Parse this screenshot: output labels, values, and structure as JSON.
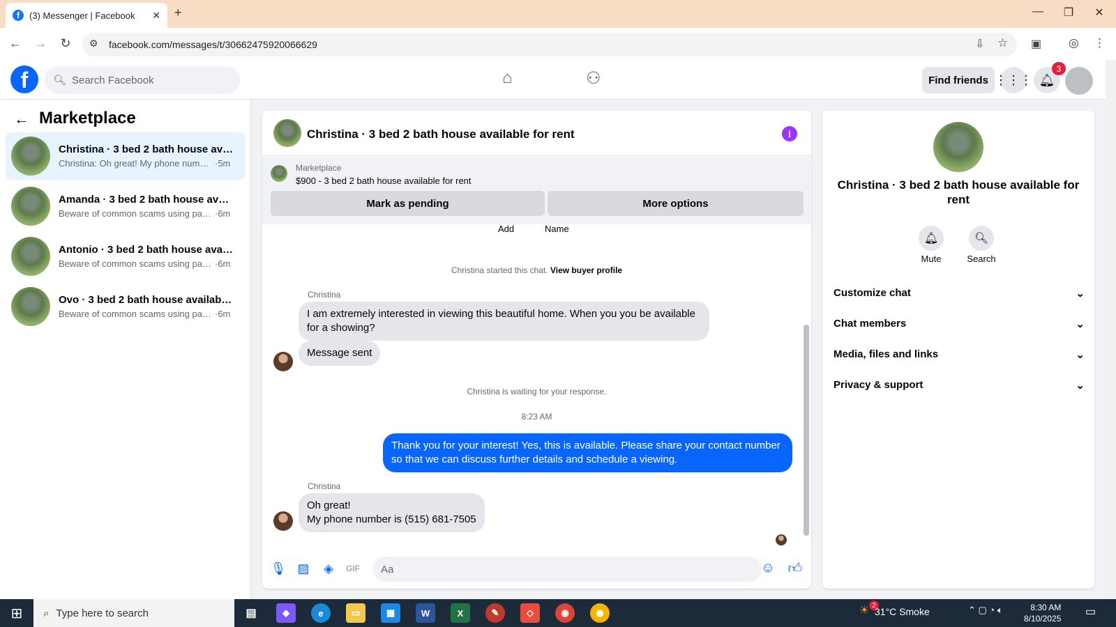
{
  "browser": {
    "tab_title": "(3) Messenger | Facebook",
    "url": "facebook.com/messages/t/30662475920066629",
    "icons": [
      "back-icon",
      "forward-icon",
      "reload-icon",
      "site-info-icon",
      "install-icon",
      "star-icon",
      "media-icon",
      "profile-icon",
      "menu-icon"
    ]
  },
  "fb_header": {
    "search_placeholder": "Search Facebook",
    "find_friends": "Find friends",
    "notif_count": "3"
  },
  "left": {
    "title": "Marketplace",
    "conversations": [
      {
        "name": "Christina · 3 bed 2 bath house avai...",
        "snippet": "Christina: Oh great! My phone numb...",
        "time": "·5m",
        "active": true
      },
      {
        "name": "Amanda · 3 bed 2 bath house avail...",
        "snippet": "Beware of common scams using pay...",
        "time": "·6m"
      },
      {
        "name": "Antonio · 3 bed 2 bath house avail...",
        "snippet": "Beware of common scams using pay...",
        "time": "·6m"
      },
      {
        "name": "Ovo · 3 bed 2 bath house available...",
        "snippet": "Beware of common scams using pay...",
        "time": "·6m"
      }
    ]
  },
  "chat": {
    "title": "Christina · 3 bed 2 bath house available for rent",
    "marketplace_label": "Marketplace",
    "listing": "$900 - 3 bed 2 bath house available for rent",
    "mark_pending": "Mark as pending",
    "more_options": "More options",
    "add_label": "Add",
    "name_label": "Name",
    "started_text": "Christina started this chat.",
    "view_profile": "View buyer profile",
    "sender1": "Christina",
    "msg1": "I am extremely interested in viewing this beautiful home. When you you be available for a showing?",
    "msg2": "Message sent",
    "waiting": "Christina is waiting for your response.",
    "time": "8:23 AM",
    "msg3": "Thank you for your interest! Yes, this is available. Please share your contact number so that we can discuss further details and schedule a viewing.",
    "sender2": "Christina",
    "msg4_line1": "Oh great!",
    "msg4_line2": "My phone number is (515) 681-7505",
    "composer_placeholder": "Aa",
    "colors": {
      "accent": "#0866ff",
      "bubble": "#e4e6eb"
    }
  },
  "right": {
    "name": "Christina · 3 bed 2 bath house available for rent",
    "mute": "Mute",
    "search": "Search",
    "sections": [
      "Customize chat",
      "Chat members",
      "Media, files and links",
      "Privacy & support"
    ]
  },
  "taskbar": {
    "search_placeholder": "Type here to search",
    "weather_badge": "2",
    "weather": "31°C  Smoke",
    "time": "8:30 AM",
    "date": "8/10/2025"
  }
}
